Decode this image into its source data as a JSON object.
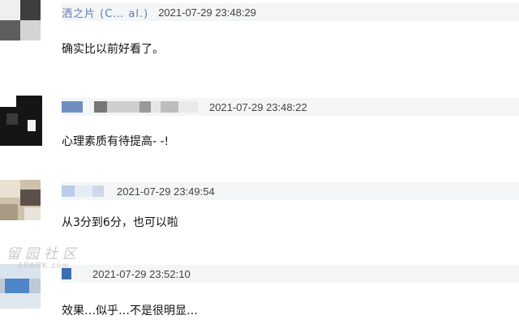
{
  "comments": [
    {
      "username": "洒之片 (C… al.)",
      "timestamp": "2021-07-29 23:48:29",
      "text": "确实比以前好看了。"
    },
    {
      "username": "",
      "timestamp": "2021-07-29 23:48:22",
      "text": "心理素质有待提高- -!"
    },
    {
      "username": "",
      "timestamp": "2021-07-29 23:49:54",
      "text": "从3分到6分，也可以啦"
    },
    {
      "username": "",
      "timestamp": "2021-07-29 23:52:10",
      "text": "效果…似乎…不是很明显…"
    }
  ],
  "watermark": {
    "cn": "留园社区",
    "en": "6PARK.com"
  },
  "colors": {
    "meta_bar": "#f3f5f6",
    "username": "#5b7bb4",
    "watermark": "#c9c9c9"
  }
}
